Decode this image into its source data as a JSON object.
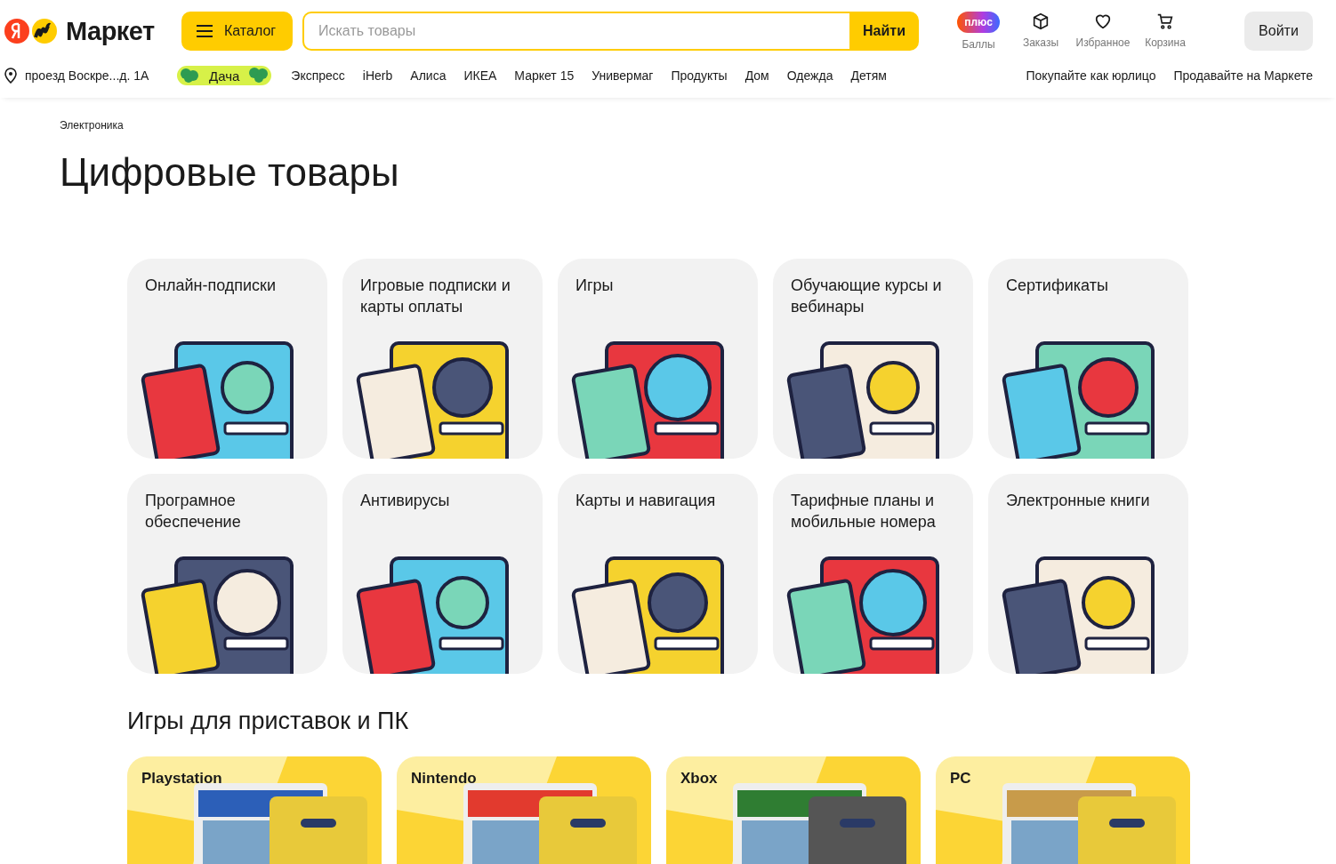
{
  "header": {
    "logo": {
      "text": "Маркет"
    },
    "catalog_button": "Каталог",
    "search": {
      "placeholder": "Искать товары",
      "button": "Найти"
    },
    "actions": [
      {
        "kind": "plus",
        "badge": "плюс",
        "label": "Баллы"
      },
      {
        "kind": "orders",
        "label": "Заказы"
      },
      {
        "kind": "favorites",
        "label": "Избранное"
      },
      {
        "kind": "cart",
        "label": "Корзина"
      }
    ],
    "login_button": "Войти"
  },
  "nav": {
    "address": "проезд Воскре...д. 1А",
    "promo_chip": "Дача",
    "links": [
      "Экспресс",
      "iHerb",
      "Алиса",
      "ИКЕА",
      "Маркет 15",
      "Универмаг",
      "Продукты",
      "Дом",
      "Одежда",
      "Детям"
    ],
    "right_links": [
      "Покупайте как юрлицо",
      "Продавайте на Маркете"
    ]
  },
  "breadcrumb": "Электроника",
  "title": "Цифровые товары",
  "categories": [
    {
      "title": "Онлайн-подписки"
    },
    {
      "title": "Игровые подписки и карты оплаты"
    },
    {
      "title": "Игры"
    },
    {
      "title": "Обучающие курсы и вебинары"
    },
    {
      "title": "Сертификаты"
    },
    {
      "title": "Програмное обеспечение"
    },
    {
      "title": "Антивирусы"
    },
    {
      "title": "Карты и навигация"
    },
    {
      "title": "Тарифные планы и мобильные номера"
    },
    {
      "title": "Электронные книги"
    }
  ],
  "games_section": {
    "title": "Игры для приставок и ПК",
    "platforms": [
      {
        "title": "Playstation"
      },
      {
        "title": "Nintendo"
      },
      {
        "title": "Xbox"
      },
      {
        "title": "PC"
      }
    ]
  }
}
